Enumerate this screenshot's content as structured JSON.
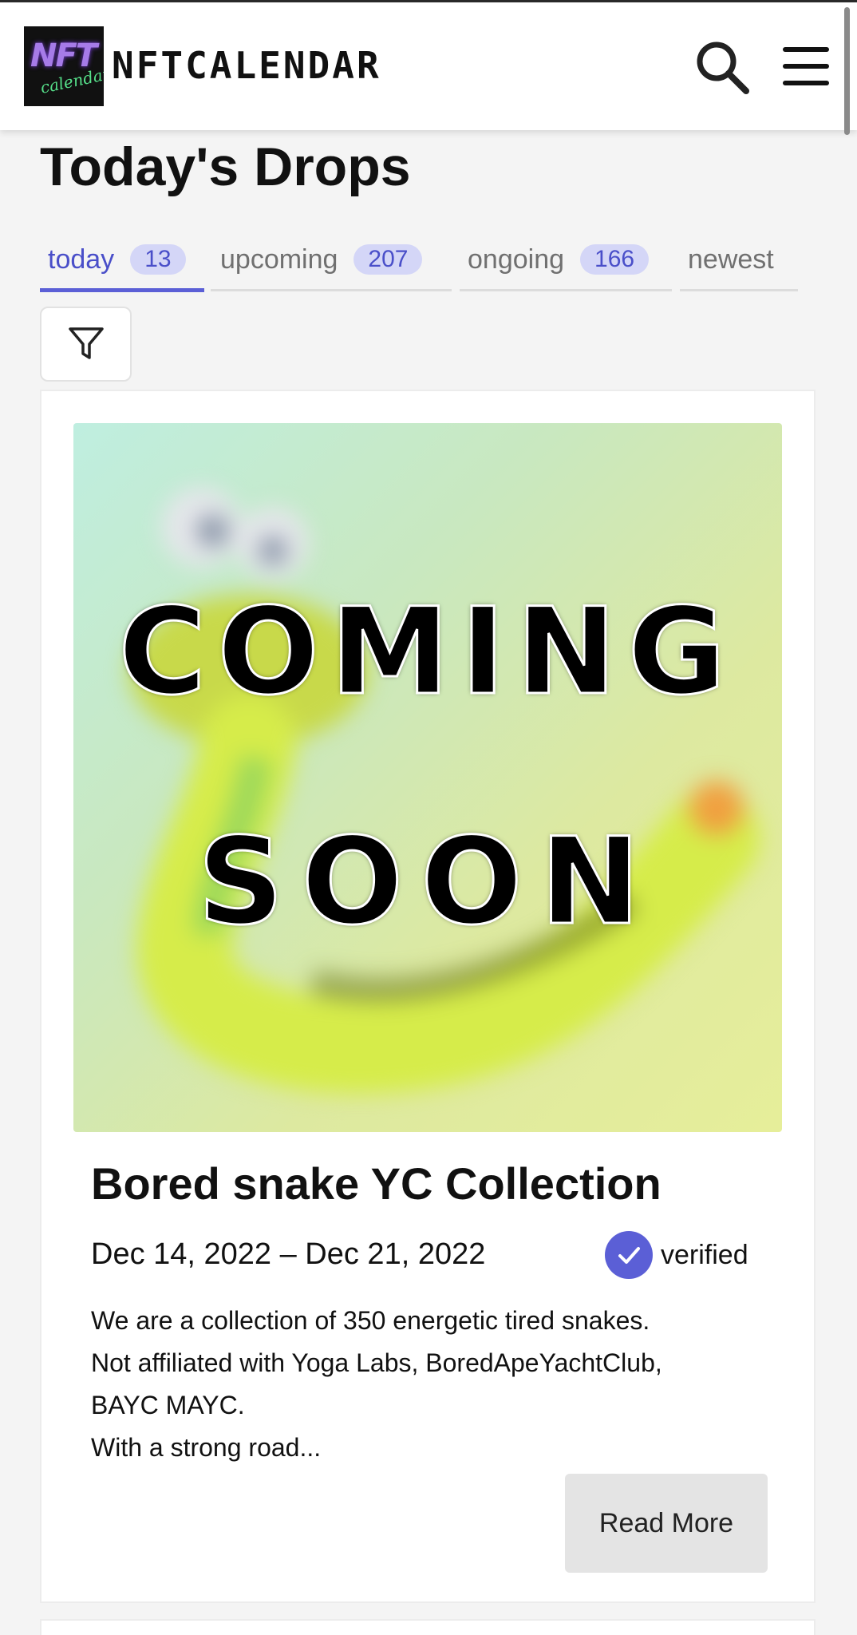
{
  "header": {
    "logo_text_top": "NFT",
    "logo_text_bottom": "calendar",
    "brand": "NFTCALENDAR",
    "icons": [
      "search-icon",
      "menu-icon"
    ]
  },
  "page": {
    "title": "Today's Drops"
  },
  "tabs": [
    {
      "label": "today",
      "count": "13",
      "active": true
    },
    {
      "label": "upcoming",
      "count": "207",
      "active": false
    },
    {
      "label": "ongoing",
      "count": "166",
      "active": false
    },
    {
      "label": "newest",
      "count": "",
      "active": false
    }
  ],
  "filter": {
    "icon": "funnel-icon"
  },
  "cards": [
    {
      "image_overlay": [
        "COMING",
        "SOON"
      ],
      "title": "Bored snake YC Collection",
      "dates": "Dec 14, 2022 – Dec 21, 2022",
      "verified_label": "verified",
      "description": [
        "We are a collection of 350 energetic tired snakes.",
        "Not affiliated with Yoga Labs, BoredApeYachtClub,",
        "BAYC MAYC.",
        "With a strong road..."
      ],
      "read_more": "Read More"
    }
  ],
  "colors": {
    "accent": "#5b5fd6",
    "badge_bg": "#d4d6f7",
    "page_bg": "#f4f4f4"
  }
}
